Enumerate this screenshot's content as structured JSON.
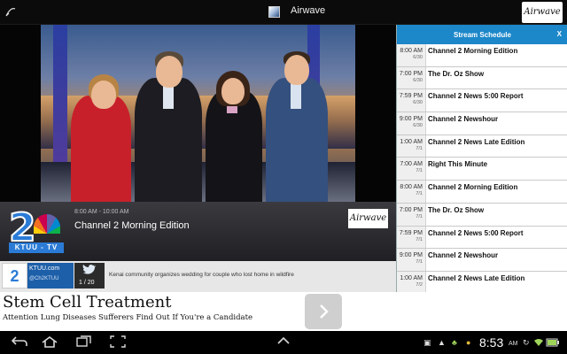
{
  "topbar": {
    "title": "Airwave",
    "logo_text": "Airwave",
    "icons": [
      "menu-icon",
      "app-icon"
    ]
  },
  "video": {
    "description_icon": "news-anchors-video"
  },
  "program": {
    "time": "8:00 AM - 10:00 AM",
    "title": "Channel 2 Morning Edition",
    "station_number": "2",
    "station_name": "KTUU - TV",
    "logo_text": "Airwave"
  },
  "social": {
    "badge": "2",
    "site": "KTUU.com",
    "handle": "@Ch2KTUU",
    "twitter_count": "1 / 20",
    "tweet": "Kenai community organizes wedding for couple who lost home in wildfire"
  },
  "schedule": {
    "title": "Stream Schedule",
    "close_label": "X",
    "items": [
      {
        "time": "8:00 AM",
        "date": "6/30",
        "name": "Channel 2 Morning Edition"
      },
      {
        "time": "7:00 PM",
        "date": "6/30",
        "name": "The Dr. Oz Show"
      },
      {
        "time": "7:59 PM",
        "date": "6/30",
        "name": "Channel 2 News 5:00 Report"
      },
      {
        "time": "9:00 PM",
        "date": "6/30",
        "name": "Channel 2 Newshour"
      },
      {
        "time": "1:00 AM",
        "date": "7/1",
        "name": "Channel 2 News Late Edition"
      },
      {
        "time": "7:00 AM",
        "date": "7/1",
        "name": "Right This Minute"
      },
      {
        "time": "8:00 AM",
        "date": "7/1",
        "name": "Channel 2 Morning Edition"
      },
      {
        "time": "7:00 PM",
        "date": "7/1",
        "name": "The Dr. Oz Show"
      },
      {
        "time": "7:59 PM",
        "date": "7/1",
        "name": "Channel 2 News 5:00 Report"
      },
      {
        "time": "9:00 PM",
        "date": "7/1",
        "name": "Channel 2 Newshour"
      },
      {
        "time": "1:00 AM",
        "date": "7/2",
        "name": "Channel 2 News Late Edition"
      }
    ]
  },
  "ad": {
    "headline": "Stem Cell Treatment",
    "subline": "Attention Lung Diseases Sufferers Find Out If You're a Candidate",
    "cta_icon": "chevron-right-icon"
  },
  "navbar": {
    "time": "8:53",
    "ampm": "AM",
    "buttons": [
      "back-icon",
      "home-icon",
      "recents-icon",
      "screenshot-icon",
      "up-icon"
    ]
  },
  "colors": {
    "accent": "#1c87c9",
    "station_blue": "#2b7bd6"
  }
}
